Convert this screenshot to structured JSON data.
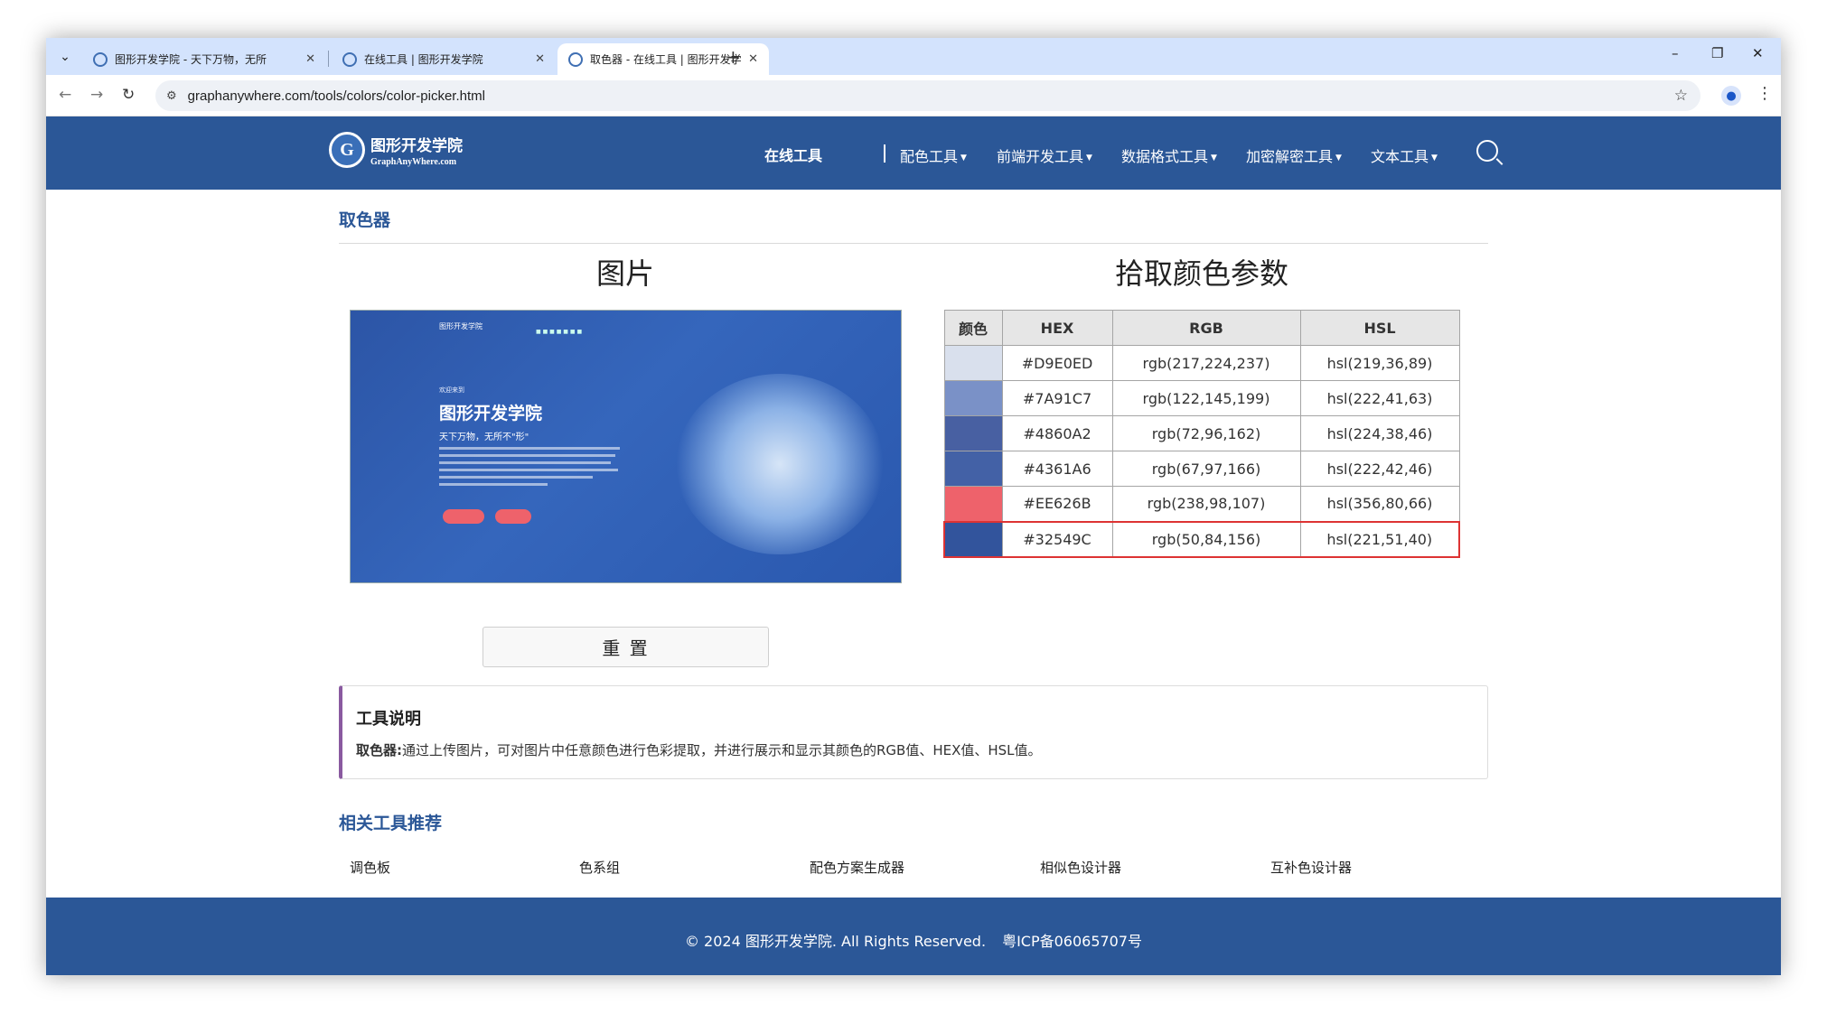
{
  "browser": {
    "tabs": [
      {
        "title": "图形开发学院 - 天下万物，无所",
        "active": false
      },
      {
        "title": "在线工具 | 图形开发学院",
        "active": false
      },
      {
        "title": "取色器 - 在线工具 | 图形开发学",
        "active": true
      }
    ],
    "url": "graphanywhere.com/tools/colors/color-picker.html"
  },
  "site": {
    "logo_cn": "图形开发学院",
    "logo_en": "GraphAnyWhere.com",
    "nav_main": "在线工具",
    "nav_items": [
      "配色工具",
      "前端开发工具",
      "数据格式工具",
      "加密解密工具",
      "文本工具"
    ]
  },
  "page": {
    "title": "取色器",
    "image_heading": "图片",
    "params_heading": "拾取颜色参数",
    "reset_label": "重 置"
  },
  "preview": {
    "logo": "图形开发学院",
    "small": "欢迎来到",
    "title": "图形开发学院",
    "subtitle": "天下万物，无所不\"形\""
  },
  "color_table": {
    "headers": [
      "颜色",
      "HEX",
      "RGB",
      "HSL"
    ],
    "rows": [
      {
        "swatch": "#D9E0ED",
        "hex": "#D9E0ED",
        "rgb": "rgb(217,224,237)",
        "hsl": "hsl(219,36,89)"
      },
      {
        "swatch": "#7A91C7",
        "hex": "#7A91C7",
        "rgb": "rgb(122,145,199)",
        "hsl": "hsl(222,41,63)"
      },
      {
        "swatch": "#4860A2",
        "hex": "#4860A2",
        "rgb": "rgb(72,96,162)",
        "hsl": "hsl(224,38,46)"
      },
      {
        "swatch": "#4361A6",
        "hex": "#4361A6",
        "rgb": "rgb(67,97,166)",
        "hsl": "hsl(222,42,46)"
      },
      {
        "swatch": "#EE626B",
        "hex": "#EE626B",
        "rgb": "rgb(238,98,107)",
        "hsl": "hsl(356,80,66)"
      },
      {
        "swatch": "#32549C",
        "hex": "#32549C",
        "rgb": "rgb(50,84,156)",
        "hsl": "hsl(221,51,40)"
      }
    ]
  },
  "description": {
    "title": "工具说明",
    "label": "取色器:",
    "text": "通过上传图片，可对图片中任意颜色进行色彩提取，并进行展示和显示其颜色的RGB值、HEX值、HSL值。"
  },
  "related": {
    "title": "相关工具推荐",
    "items": [
      "调色板",
      "色系组",
      "配色方案生成器",
      "相似色设计器",
      "互补色设计器"
    ]
  },
  "footer": {
    "copyright": "© 2024 图形开发学院. All Rights Reserved.",
    "icp": "粤ICP备06065707号"
  },
  "colors": {
    "brand": "#2b5797",
    "selected_border": "#dd3333"
  }
}
